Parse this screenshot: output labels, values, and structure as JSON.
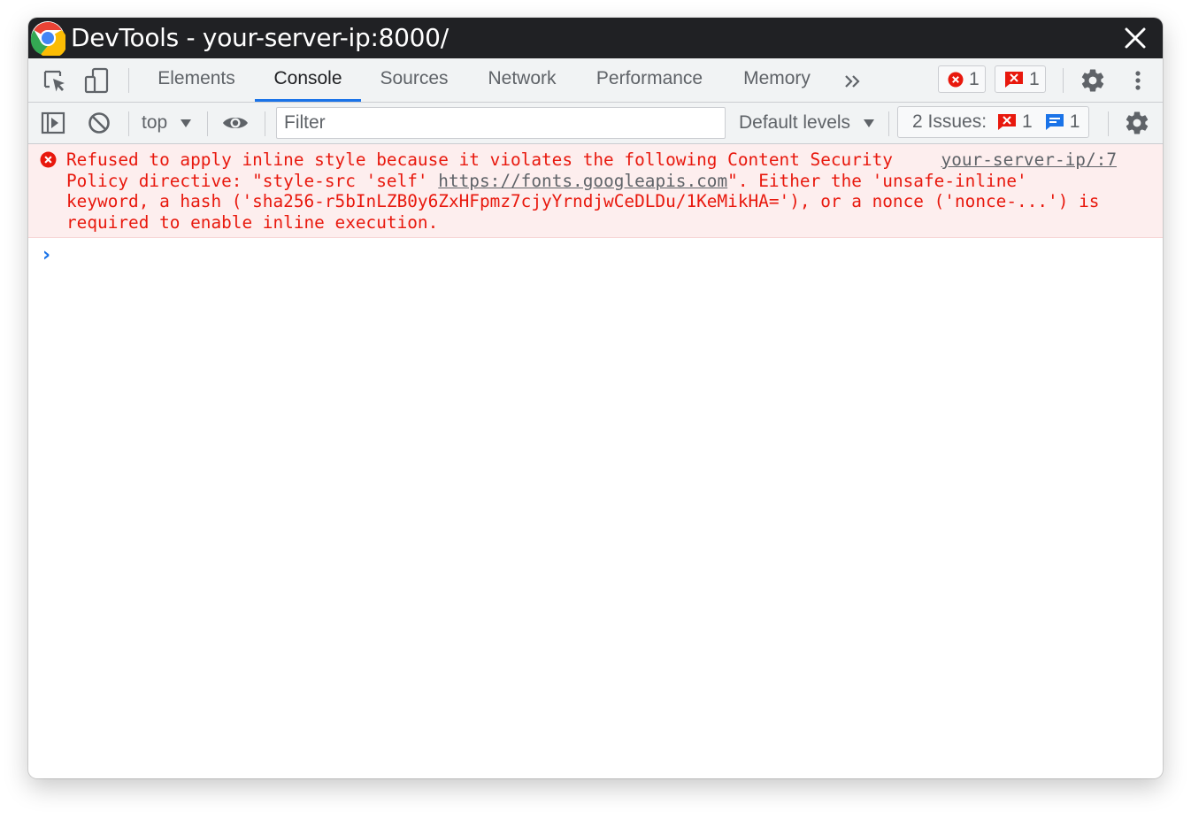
{
  "window": {
    "title": "DevTools - your-server-ip:8000/"
  },
  "tabs": [
    {
      "label": "Elements",
      "active": false
    },
    {
      "label": "Console",
      "active": true
    },
    {
      "label": "Sources",
      "active": false
    },
    {
      "label": "Network",
      "active": false
    },
    {
      "label": "Performance",
      "active": false
    },
    {
      "label": "Memory",
      "active": false
    }
  ],
  "toolbar_badges": {
    "errors": "1",
    "issues": "1"
  },
  "console_toolbar": {
    "context": "top",
    "filter_placeholder": "Filter",
    "levels": "Default levels",
    "issues_label": "2 Issues:",
    "issues_error_count": "1",
    "issues_info_count": "1"
  },
  "messages": [
    {
      "level": "error",
      "source": "your-server-ip/:7",
      "line1": "Refused to apply inline style because it violates the following Content Security",
      "line2_pre": "Policy directive: \"style-src 'self' ",
      "line2_link": "https://fonts.googleapis.com",
      "line2_post": "\". Either the 'unsafe-inline'",
      "line3": "keyword, a hash ('sha256-r5bInLZB0y6ZxHFpmz7cjyYrndjwCeDLDu/1KeMikHA='), or a nonce ('nonce-...') is",
      "line4": "required to enable inline execution."
    }
  ],
  "prompt_symbol": "›",
  "colors": {
    "titlebar": "#202124",
    "toolbar": "#f1f3f4",
    "accent": "#1a73e8",
    "error_text": "#e8180d",
    "error_bg": "#fdeeee"
  },
  "icons": [
    "chrome-logo-icon",
    "close-icon",
    "inspect-element-icon",
    "device-toolbar-icon",
    "more-tabs-icon",
    "error-circle-icon",
    "error-flag-icon",
    "settings-gear-icon",
    "more-vert-icon",
    "sidebar-toggle-icon",
    "clear-console-icon",
    "eye-icon",
    "info-message-icon"
  ]
}
